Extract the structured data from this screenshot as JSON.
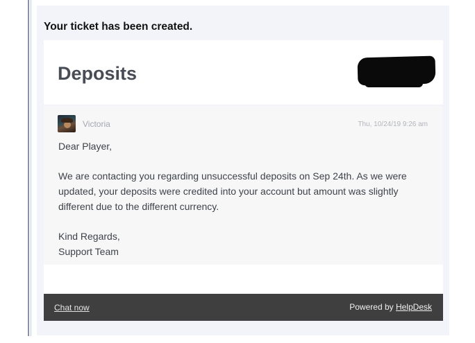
{
  "email": {
    "notice": "Your ticket has been created.",
    "ticket_title": "Deposits"
  },
  "message": {
    "sender": "Victoria",
    "timestamp": "Thu, 10/24/19 9:26 am",
    "greeting": "Dear Player,",
    "body": "We are contacting you regarding unsuccessful deposits on Sep 24th. As we were updated, your deposits were credited into your account but amount was slightly different due to the different currency.",
    "closing": "Kind Regards,",
    "signature": "Support Team"
  },
  "footer": {
    "chat_label": "Chat now",
    "powered_prefix": "Powered by",
    "brand": "HelpDesk"
  }
}
